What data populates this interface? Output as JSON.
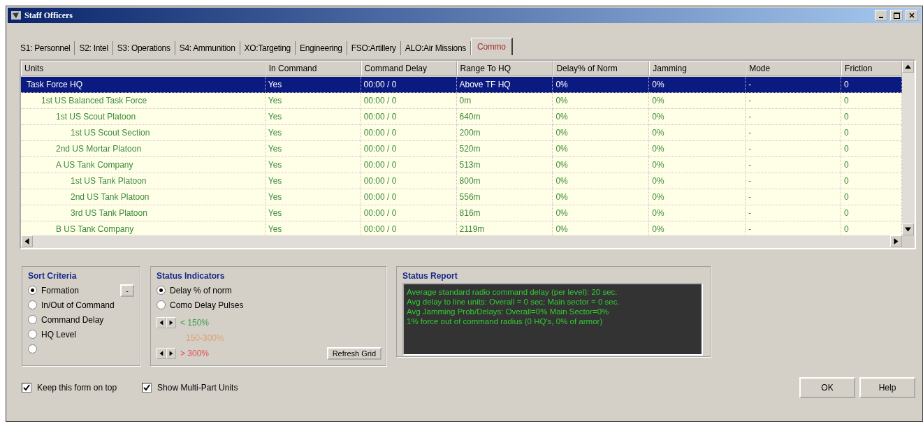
{
  "window": {
    "title": "Staff Officers"
  },
  "tabs": [
    {
      "label": "S1: Personnel",
      "selected": false
    },
    {
      "label": "S2: Intel",
      "selected": false
    },
    {
      "label": "S3: Operations",
      "selected": false
    },
    {
      "label": "S4: Ammunition",
      "selected": false
    },
    {
      "label": "XO:Targeting",
      "selected": false
    },
    {
      "label": "Engineering",
      "selected": false
    },
    {
      "label": "FSO:Artillery",
      "selected": false
    },
    {
      "label": "ALO:Air Missions",
      "selected": false
    },
    {
      "label": "Commo",
      "selected": true
    }
  ],
  "table": {
    "columns": [
      "Units",
      "In Command",
      "Command Delay",
      "Range To HQ",
      "Delay% of Norm",
      "Jamming",
      "Mode",
      "Friction"
    ],
    "rows": [
      {
        "cells": [
          "Task Force HQ",
          "Yes",
          "00:00 / 0",
          "Above TF HQ",
          "0%",
          "0%",
          "-",
          "0"
        ],
        "selected": true,
        "children": [
          {
            "cells": [
              "1st US Balanced Task Force",
              "Yes",
              "00:00 / 0",
              "0m",
              "0%",
              "0%",
              "-",
              "0"
            ],
            "selected": false,
            "children": [
              {
                "cells": [
                  "1st US Scout Platoon",
                  "Yes",
                  "00:00 / 0",
                  "640m",
                  "0%",
                  "0%",
                  "-",
                  "0"
                ],
                "selected": false,
                "children": [
                  {
                    "cells": [
                      "1st US Scout Section",
                      "Yes",
                      "00:00 / 0",
                      "200m",
                      "0%",
                      "0%",
                      "-",
                      "0"
                    ],
                    "selected": false
                  }
                ]
              },
              {
                "cells": [
                  "2nd US Mortar Platoon",
                  "Yes",
                  "00:00 / 0",
                  "520m",
                  "0%",
                  "0%",
                  "-",
                  "0"
                ],
                "selected": false
              },
              {
                "cells": [
                  "A  US Tank Company",
                  "Yes",
                  "00:00 / 0",
                  "513m",
                  "0%",
                  "0%",
                  "-",
                  "0"
                ],
                "selected": false,
                "children": [
                  {
                    "cells": [
                      "1st US Tank Platoon",
                      "Yes",
                      "00:00 / 0",
                      "800m",
                      "0%",
                      "0%",
                      "-",
                      "0"
                    ],
                    "selected": false
                  },
                  {
                    "cells": [
                      "2nd US Tank Platoon",
                      "Yes",
                      "00:00 / 0",
                      "556m",
                      "0%",
                      "0%",
                      "-",
                      "0"
                    ],
                    "selected": false
                  },
                  {
                    "cells": [
                      "3rd US Tank Platoon",
                      "Yes",
                      "00:00 / 0",
                      "816m",
                      "0%",
                      "0%",
                      "-",
                      "0"
                    ],
                    "selected": false
                  }
                ]
              },
              {
                "cells": [
                  "B  US Tank Company",
                  "Yes",
                  "00:00 / 0",
                  "2119m",
                  "0%",
                  "0%",
                  "-",
                  "0"
                ],
                "selected": false
              }
            ]
          }
        ]
      }
    ]
  },
  "sort_criteria": {
    "title": "Sort Criteria",
    "button": "-",
    "options": [
      {
        "label": "Formation",
        "selected": true
      },
      {
        "label": "In/Out of Command",
        "selected": false
      },
      {
        "label": "Command Delay",
        "selected": false
      },
      {
        "label": "HQ Level",
        "selected": false
      },
      {
        "selected": false
      }
    ]
  },
  "status_indicators": {
    "title": "Status Indicators",
    "options": [
      {
        "label": "Delay % of norm",
        "selected": true
      },
      {
        "label": "Como Delay Pulses",
        "selected": false
      }
    ],
    "thresholds": [
      {
        "label": "< 150%",
        "color": "#3aa04a",
        "spinner": true
      },
      {
        "label": "150-300%",
        "color": "#e0a070",
        "spinner": false
      },
      {
        "label": "> 300%",
        "color": "#e05050",
        "spinner": true
      }
    ],
    "refresh_button": "Refresh Grid"
  },
  "status_report": {
    "title": "Status Report",
    "lines": [
      "Average standard radio command delay (per level): 20 sec.",
      "Avg delay to line units: Overall = 0 sec;  Main sector = 0 sec.",
      "Avg Jamming Prob/Delays: Overall=0%  Main Sector=0%",
      "1% force out of command radius (0 HQ's, 0% of armor)"
    ]
  },
  "footer": {
    "checkboxes": [
      {
        "label": "Keep this form on top",
        "checked": true
      },
      {
        "label": "Show Multi-Part Units",
        "checked": true
      }
    ],
    "buttons": [
      "OK",
      "Help"
    ]
  }
}
